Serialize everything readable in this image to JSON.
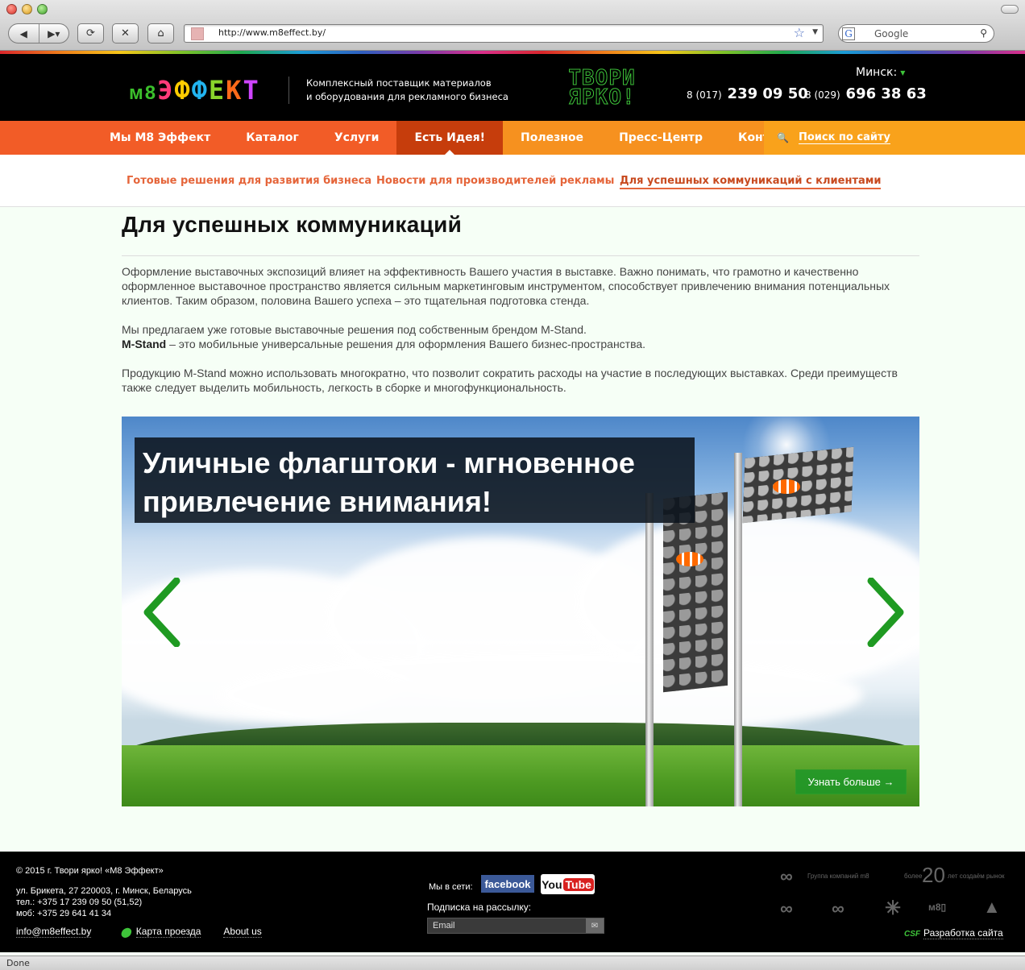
{
  "browser": {
    "url": "http://www.m8effect.by/",
    "search_placeholder": "Google",
    "status": "Done"
  },
  "header": {
    "logo_prefix": "м8",
    "logo_letters": [
      "Э",
      "Ф",
      "Ф",
      "Е",
      "К",
      "Т"
    ],
    "tagline_line1": "Комплексный поставщик материалов",
    "tagline_line2": "и оборудования  для рекламного бизнеса",
    "slogan_line1": "ТВОРИ",
    "slogan_line2": "ЯРКО!",
    "city": "Минск:",
    "phones": [
      {
        "code": "8 (017)",
        "number": "239 09 50"
      },
      {
        "code": "8 (029)",
        "number": "696 38 63"
      }
    ]
  },
  "menu": {
    "items": [
      "Мы М8 Эффект",
      "Каталог",
      "Услуги",
      "Есть Идея!",
      "Полезное",
      "Пресс-Центр",
      "Контакты"
    ],
    "active_index": 3,
    "search_label": "Поиск по сайту"
  },
  "submenu": {
    "items": [
      "Готовые решения для развития бизнеса",
      "Новости для производителей рекламы",
      "Для успешных коммуникаций с клиентами"
    ],
    "active_index": 2
  },
  "content": {
    "title": "Для успешных коммуникаций",
    "para1": "Оформление выставочных экспозиций влияет на эффективность Вашего участия в выставке. Важно понимать, что грамотно и качественно оформленное выставочное пространство является сильным маркетинговым инструментом, способствует привлечению внимания потенциальных клиентов. Таким образом, половина Вашего успеха – это тщательная подготовка стенда.",
    "para2_line1": "Мы предлагаем уже готовые выставочные решения под собственным брендом M-Stand.",
    "para2_bold": "M-Stand",
    "para2_rest": " – это мобильные универсальные решения для оформления Вашего бизнес-пространства.",
    "para3": "Продукцию M-Stand можно использовать многократно, что позволит сократить расходы на участие в последующих выставках. Среди преимуществ также следует выделить мобильность, легкость в сборке и многофункциональность."
  },
  "banner": {
    "title_line1": "Уличные флагштоки - мгновенное",
    "title_line2": "привлечение внимания!",
    "more_label": "Узнать больше →"
  },
  "footer": {
    "copyright": "© 2015 г. Твори ярко! «М8 Эффект»",
    "address": "ул. Брикета, 27 220003, г. Минск, Беларусь",
    "tel": "тел.: +375 17 239 09 50 (51,52)",
    "mob": "моб: +375 29 641 41 34",
    "email": "info@m8effect.by",
    "map_link": "Карта проезда",
    "about_link": "About us",
    "social_label": "Мы в сети:",
    "facebook": "facebook",
    "youtube_you": "You",
    "youtube_tube": "Tube",
    "subscribe_label": "Подписка на рассылку:",
    "email_placeholder": "Email",
    "group_text": "Группа компаний m8",
    "anniv_pre": "более",
    "anniv_num": "20",
    "anniv_post": "лет создаём рынок",
    "dev_brand": "CSF",
    "dev_link": "Разработка сайта"
  }
}
